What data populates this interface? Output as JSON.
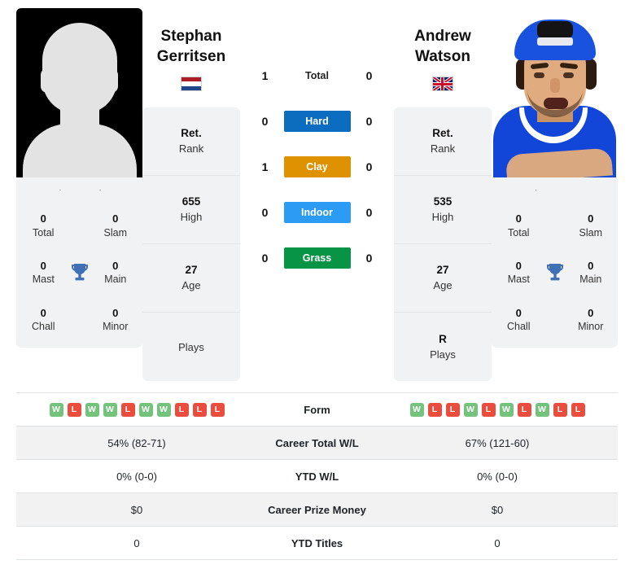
{
  "players": {
    "left": {
      "name_line1": "Stephan",
      "name_line2": "Gerritsen",
      "full_name": "Stephan Gerritsen",
      "photo_caption": "Stephan Gerritsen",
      "flag": "netherlands-flag",
      "photo": "silhouette-placeholder",
      "info": [
        {
          "value": "Ret.",
          "label": "Rank"
        },
        {
          "value": "655",
          "label": "High"
        },
        {
          "value": "27",
          "label": "Age"
        },
        {
          "value": "",
          "label": "Plays"
        }
      ],
      "titles": [
        {
          "value": "0",
          "label": "Total"
        },
        {
          "value": "0",
          "label": "Slam"
        },
        {
          "value": "0",
          "label": "Mast"
        },
        {
          "value": "0",
          "label": "Main"
        },
        {
          "value": "0",
          "label": "Chall"
        },
        {
          "value": "0",
          "label": "Minor"
        }
      ],
      "form": [
        "W",
        "L",
        "W",
        "W",
        "L",
        "W",
        "W",
        "L",
        "L",
        "L"
      ]
    },
    "right": {
      "name_line1": "Andrew",
      "name_line2": "Watson",
      "full_name": "Andrew Watson",
      "photo_caption": "Andrew Watson",
      "flag": "united-kingdom-flag",
      "photo": "player-photo",
      "info": [
        {
          "value": "Ret.",
          "label": "Rank"
        },
        {
          "value": "535",
          "label": "High"
        },
        {
          "value": "27",
          "label": "Age"
        },
        {
          "value": "R",
          "label": "Plays"
        }
      ],
      "titles": [
        {
          "value": "0",
          "label": "Total"
        },
        {
          "value": "0",
          "label": "Slam"
        },
        {
          "value": "0",
          "label": "Mast"
        },
        {
          "value": "0",
          "label": "Main"
        },
        {
          "value": "0",
          "label": "Chall"
        },
        {
          "value": "0",
          "label": "Minor"
        }
      ],
      "form": [
        "W",
        "L",
        "L",
        "W",
        "L",
        "W",
        "L",
        "W",
        "L",
        "L"
      ]
    }
  },
  "surfaces": [
    {
      "label": "Total",
      "left": "1",
      "right": "0",
      "style": "plain",
      "color": ""
    },
    {
      "label": "Hard",
      "left": "0",
      "right": "0",
      "style": "badge",
      "color": "#0b6cc0"
    },
    {
      "label": "Clay",
      "left": "1",
      "right": "0",
      "style": "badge",
      "color": "#df9200"
    },
    {
      "label": "Indoor",
      "left": "0",
      "right": "0",
      "style": "badge",
      "color": "#2c9bf4"
    },
    {
      "label": "Grass",
      "left": "0",
      "right": "0",
      "style": "badge",
      "color": "#079447"
    }
  ],
  "stats_rows": [
    {
      "label": "Form",
      "left": "",
      "right": "",
      "type": "form",
      "striped": false
    },
    {
      "label": "Career Total W/L",
      "left": "54% (82-71)",
      "right": "67% (121-60)",
      "type": "text",
      "striped": true
    },
    {
      "label": "YTD W/L",
      "left": "0% (0-0)",
      "right": "0% (0-0)",
      "type": "text",
      "striped": false
    },
    {
      "label": "Career Prize Money",
      "left": "$0",
      "right": "$0",
      "type": "text",
      "striped": true
    },
    {
      "label": "YTD Titles",
      "left": "0",
      "right": "0",
      "type": "text",
      "striped": false
    }
  ],
  "colors": {
    "win_badge": "#73c37d",
    "loss_badge": "#ea4d3d",
    "trophy": "#3f6fb5",
    "panel_bg": "#f1f2f3"
  }
}
